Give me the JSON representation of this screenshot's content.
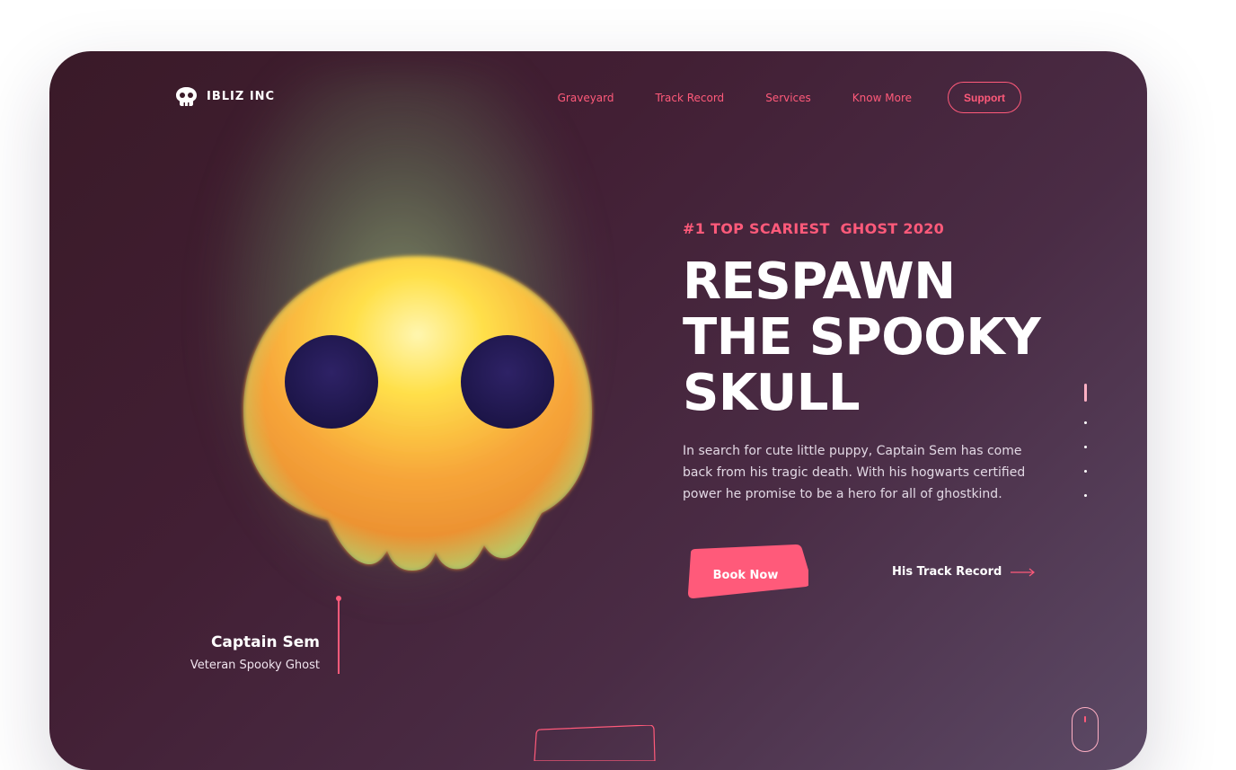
{
  "brand": {
    "name": "IBLIZ INC",
    "logo_icon": "skull-icon"
  },
  "nav": {
    "items": [
      "Graveyard",
      "Track Record",
      "Services",
      "Know More"
    ],
    "support_label": "Support"
  },
  "hero": {
    "eyebrow": "#1 TOP SCARIEST  GHOST 2020",
    "headline": [
      "RESPAWN",
      "THE SPOOKY",
      "SKULL"
    ],
    "description": "In search for cute little puppy, Captain Sem has come back from his tragic death. With his hogwarts certified power he promise to be a hero for all of ghostkind.",
    "book_label": "Book Now",
    "track_label": "His Track Record"
  },
  "character": {
    "name": "Captain Sem",
    "role": "Veteran Spooky Ghost"
  },
  "pagination": {
    "total": 5,
    "active": 1
  },
  "colors": {
    "accent": "#ff5a7a",
    "background": "#421f34",
    "text": "#ffffff"
  }
}
